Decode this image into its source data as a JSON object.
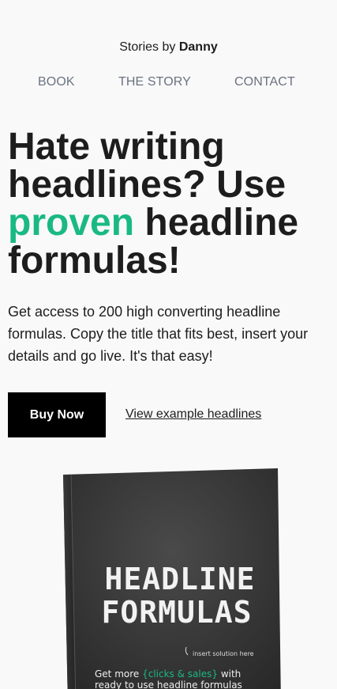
{
  "header": {
    "brand_prefix": "Stories by ",
    "brand_name": "Danny"
  },
  "nav": {
    "items": [
      {
        "label": "BOOK"
      },
      {
        "label": "THE STORY"
      },
      {
        "label": "CONTACT"
      }
    ]
  },
  "hero": {
    "title_part1": "Hate writing headlines? Use ",
    "title_accent": "proven",
    "title_part2": " headline formulas!",
    "lead": "Get access to 200 high converting headline formulas. Copy the title that fits best, insert your details and go live. It's that easy!",
    "buy_label": "Buy Now",
    "example_label": "View example headlines"
  },
  "book": {
    "title_line1": "HEADLINE",
    "title_line2": "FORMULAS",
    "tagline_line1_before": "Get more ",
    "tagline_highlight": "{clicks & sales}",
    "tagline_line1_after": " with",
    "tagline_line2": "ready to use headline formulas",
    "annotation": "insert solution here"
  },
  "colors": {
    "accent": "#1ab983",
    "background": "#f9f9f9",
    "button": "#000000"
  }
}
